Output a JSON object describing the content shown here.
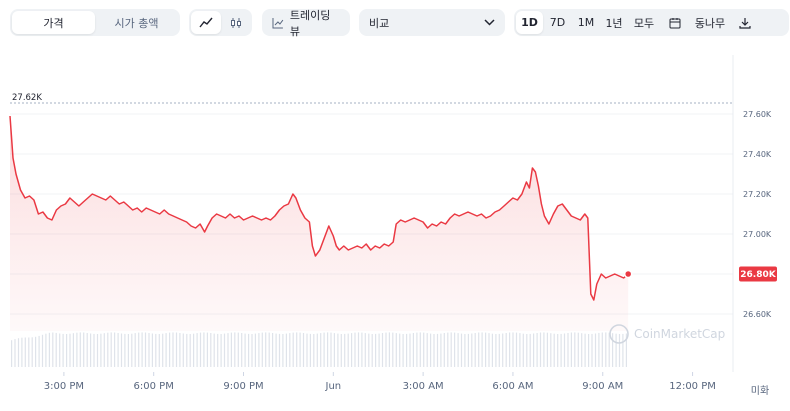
{
  "toolbar": {
    "price_tab": "가격",
    "market_cap_tab": "시가 총액",
    "line_icon": "line-chart-icon",
    "candle_icon": "candlestick-icon",
    "tradingview_label": "트레이딩뷰",
    "compare_label": "비교",
    "ranges": [
      "1D",
      "7D",
      "1M",
      "1년",
      "모두"
    ],
    "active_range": "1D",
    "calendar_icon": "calendar-icon",
    "export_label": "동나무",
    "download_icon": "download-icon"
  },
  "chart_data": {
    "type": "area",
    "y_unit": "USD",
    "ylim": [
      26460,
      27720
    ],
    "y_ticks": [
      26600,
      26800,
      27000,
      27200,
      27400,
      27600
    ],
    "y_tick_labels": [
      "26.60K",
      "26.80K",
      "27.00K",
      "27.20K",
      "27.40K",
      "27.60K"
    ],
    "x_tick_labels": [
      "3:00 PM",
      "6:00 PM",
      "9:00 PM",
      "Jun",
      "3:00 AM",
      "6:00 AM",
      "9:00 AM",
      "12:00 PM"
    ],
    "x_tick_hours": [
      3,
      6,
      9,
      12,
      15,
      18,
      21,
      24
    ],
    "x_range_hours": [
      1.2,
      24.95
    ],
    "max_label": "27.62K",
    "max_value": 27620,
    "current_label": "26.80K",
    "current_value": 26800,
    "legend_note": "미화",
    "watermark": "CoinMarketCap",
    "line_color": "#ea3943",
    "grid": true,
    "points": [
      [
        1.2,
        27590
      ],
      [
        1.3,
        27380
      ],
      [
        1.4,
        27300
      ],
      [
        1.55,
        27220
      ],
      [
        1.7,
        27180
      ],
      [
        1.85,
        27190
      ],
      [
        2.0,
        27170
      ],
      [
        2.15,
        27100
      ],
      [
        2.3,
        27110
      ],
      [
        2.45,
        27080
      ],
      [
        2.6,
        27070
      ],
      [
        2.75,
        27120
      ],
      [
        2.9,
        27140
      ],
      [
        3.05,
        27150
      ],
      [
        3.2,
        27180
      ],
      [
        3.35,
        27160
      ],
      [
        3.5,
        27140
      ],
      [
        3.65,
        27160
      ],
      [
        3.8,
        27180
      ],
      [
        3.95,
        27200
      ],
      [
        4.1,
        27190
      ],
      [
        4.25,
        27180
      ],
      [
        4.4,
        27170
      ],
      [
        4.55,
        27190
      ],
      [
        4.7,
        27170
      ],
      [
        4.85,
        27150
      ],
      [
        5.0,
        27160
      ],
      [
        5.15,
        27140
      ],
      [
        5.3,
        27120
      ],
      [
        5.45,
        27130
      ],
      [
        5.6,
        27110
      ],
      [
        5.75,
        27130
      ],
      [
        5.9,
        27120
      ],
      [
        6.05,
        27110
      ],
      [
        6.2,
        27100
      ],
      [
        6.35,
        27120
      ],
      [
        6.5,
        27100
      ],
      [
        6.65,
        27090
      ],
      [
        6.8,
        27080
      ],
      [
        6.95,
        27070
      ],
      [
        7.1,
        27060
      ],
      [
        7.25,
        27040
      ],
      [
        7.4,
        27030
      ],
      [
        7.55,
        27050
      ],
      [
        7.7,
        27010
      ],
      [
        7.8,
        27040
      ],
      [
        7.95,
        27080
      ],
      [
        8.1,
        27100
      ],
      [
        8.25,
        27090
      ],
      [
        8.4,
        27080
      ],
      [
        8.55,
        27100
      ],
      [
        8.7,
        27080
      ],
      [
        8.85,
        27090
      ],
      [
        9.0,
        27070
      ],
      [
        9.15,
        27080
      ],
      [
        9.3,
        27090
      ],
      [
        9.45,
        27080
      ],
      [
        9.6,
        27070
      ],
      [
        9.75,
        27080
      ],
      [
        9.9,
        27070
      ],
      [
        10.05,
        27090
      ],
      [
        10.2,
        27120
      ],
      [
        10.35,
        27140
      ],
      [
        10.5,
        27150
      ],
      [
        10.65,
        27200
      ],
      [
        10.75,
        27180
      ],
      [
        10.9,
        27120
      ],
      [
        11.05,
        27080
      ],
      [
        11.2,
        27060
      ],
      [
        11.3,
        26940
      ],
      [
        11.4,
        26890
      ],
      [
        11.55,
        26920
      ],
      [
        11.7,
        26980
      ],
      [
        11.85,
        27040
      ],
      [
        12.0,
        26990
      ],
      [
        12.1,
        26940
      ],
      [
        12.2,
        26920
      ],
      [
        12.35,
        26940
      ],
      [
        12.5,
        26920
      ],
      [
        12.65,
        26930
      ],
      [
        12.8,
        26940
      ],
      [
        12.95,
        26930
      ],
      [
        13.1,
        26950
      ],
      [
        13.25,
        26920
      ],
      [
        13.4,
        26940
      ],
      [
        13.55,
        26930
      ],
      [
        13.7,
        26950
      ],
      [
        13.85,
        26940
      ],
      [
        14.0,
        26960
      ],
      [
        14.1,
        27050
      ],
      [
        14.25,
        27070
      ],
      [
        14.4,
        27060
      ],
      [
        14.55,
        27070
      ],
      [
        14.7,
        27080
      ],
      [
        14.85,
        27070
      ],
      [
        15.0,
        27060
      ],
      [
        15.15,
        27030
      ],
      [
        15.3,
        27050
      ],
      [
        15.45,
        27040
      ],
      [
        15.6,
        27060
      ],
      [
        15.75,
        27050
      ],
      [
        15.9,
        27080
      ],
      [
        16.05,
        27100
      ],
      [
        16.2,
        27090
      ],
      [
        16.35,
        27100
      ],
      [
        16.5,
        27110
      ],
      [
        16.65,
        27100
      ],
      [
        16.8,
        27090
      ],
      [
        16.95,
        27100
      ],
      [
        17.1,
        27080
      ],
      [
        17.25,
        27090
      ],
      [
        17.4,
        27110
      ],
      [
        17.55,
        27120
      ],
      [
        17.7,
        27140
      ],
      [
        17.85,
        27160
      ],
      [
        18.0,
        27180
      ],
      [
        18.15,
        27170
      ],
      [
        18.3,
        27200
      ],
      [
        18.45,
        27260
      ],
      [
        18.55,
        27230
      ],
      [
        18.65,
        27330
      ],
      [
        18.75,
        27310
      ],
      [
        18.85,
        27240
      ],
      [
        18.95,
        27150
      ],
      [
        19.05,
        27090
      ],
      [
        19.2,
        27050
      ],
      [
        19.35,
        27100
      ],
      [
        19.5,
        27140
      ],
      [
        19.65,
        27150
      ],
      [
        19.8,
        27120
      ],
      [
        19.95,
        27090
      ],
      [
        20.1,
        27080
      ],
      [
        20.25,
        27070
      ],
      [
        20.4,
        27100
      ],
      [
        20.5,
        27080
      ],
      [
        20.6,
        26700
      ],
      [
        20.7,
        26670
      ],
      [
        20.8,
        26750
      ],
      [
        20.95,
        26800
      ],
      [
        21.1,
        26780
      ],
      [
        21.25,
        26790
      ],
      [
        21.4,
        26800
      ],
      [
        21.55,
        26790
      ],
      [
        21.7,
        26780
      ],
      [
        21.85,
        26800
      ]
    ],
    "volume_note": "Volume bars are unlabeled; rendered as uniform baseline bars."
  }
}
